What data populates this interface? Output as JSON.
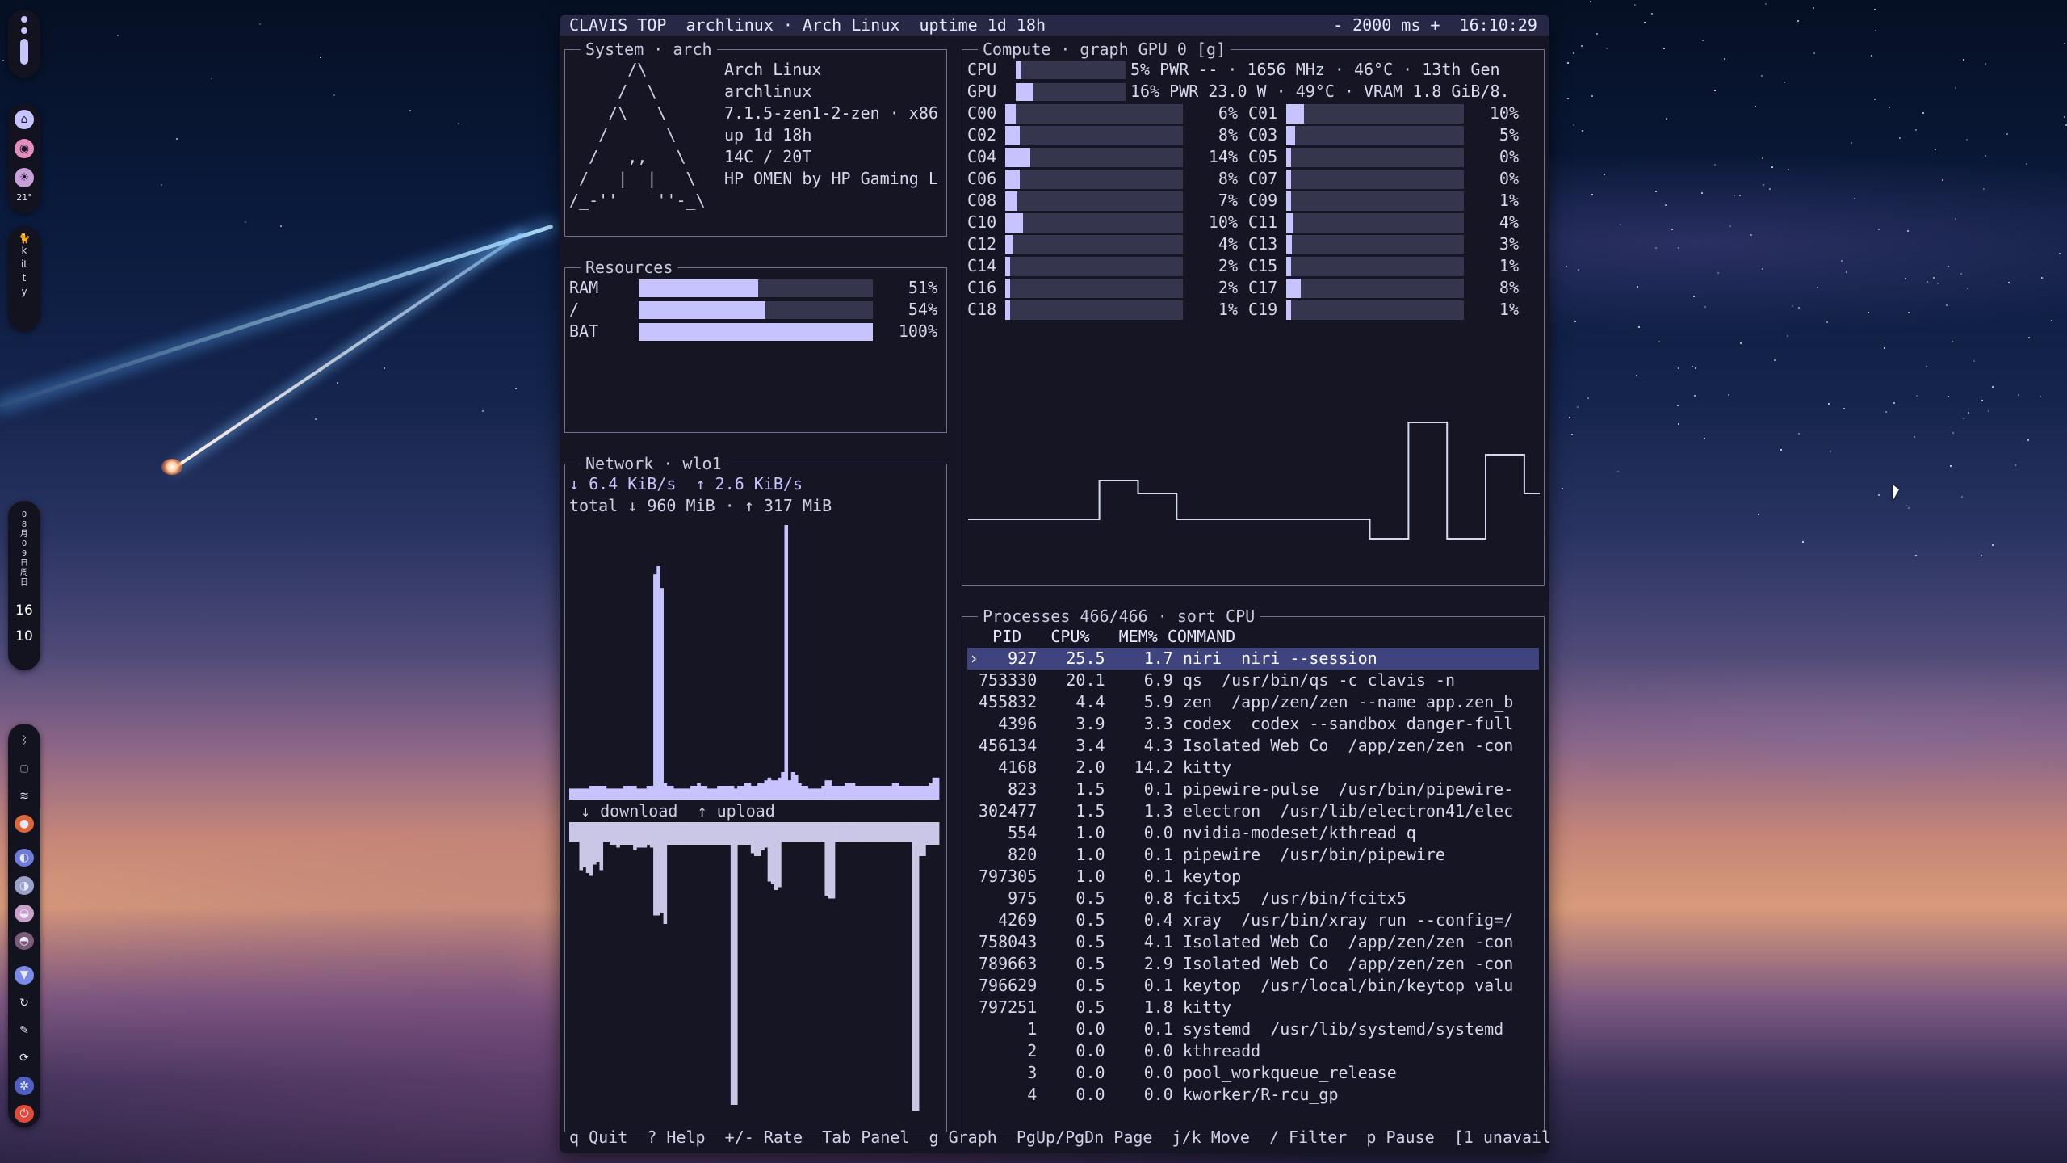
{
  "colors": {
    "accent": "#c6c3ff",
    "track": "#35364e",
    "bg": "#161524",
    "selection": "#3f437e"
  },
  "dock": {
    "top_icons": [
      "battery-icon",
      "bell-icon",
      "record-icon",
      "brightness-icon"
    ],
    "temperature": "21°",
    "kitty_label": "kitty",
    "date_text": "08月09日周日",
    "hour": "16",
    "minute": "10",
    "bottom_icons": [
      "bluetooth-icon",
      "clipboard-icon",
      "wifi-icon",
      "antivirus-icon",
      "gpu-icon",
      "audio-icon",
      "brightness-small-icon",
      "moon-icon",
      "network-icon",
      "performance-icon",
      "tools-icon",
      "settings-icon",
      "power-icon"
    ]
  },
  "title_bar": {
    "left": "CLAVIS TOP  archlinux · Arch Linux  uptime 1d 18h",
    "right": "- 2000 ms +  16:10:29"
  },
  "system": {
    "title": "System · arch",
    "art": [
      "      /\\",
      "     /  \\",
      "    /\\   \\",
      "   /      \\",
      "  /   ,,   \\",
      " /   |  |   \\",
      "/_-''    ''-_\\"
    ],
    "info": [
      "Arch Linux",
      "archlinux",
      "7.1.5-zen1-2-zen · x86",
      "up 1d 18h",
      "14C / 20T",
      "HP OMEN by HP Gaming L"
    ]
  },
  "resources": {
    "title": "Resources",
    "rows": [
      {
        "label": "RAM",
        "value": "51%",
        "fraction": 0.51
      },
      {
        "label": "/",
        "value": "54%",
        "fraction": 0.54
      },
      {
        "label": "BAT",
        "value": "100%",
        "fraction": 1.0
      }
    ]
  },
  "network": {
    "title": "Network · wlo1",
    "rates": "↓ 6.4 KiB/s  ↑ 2.6 KiB/s",
    "totals": "total ↓ 960 MiB · ↑ 317 MiB",
    "legend": "↓ download  ↑ upload",
    "download_history": [
      0.04,
      0.04,
      0.04,
      0.04,
      0.04,
      0.04,
      0.05,
      0.05,
      0.05,
      0.05,
      0.05,
      0.04,
      0.04,
      0.04,
      0.04,
      0.04,
      0.05,
      0.05,
      0.05,
      0.05,
      0.04,
      0.04,
      0.04,
      0.05,
      0.05,
      0.82,
      0.85,
      0.77,
      0.06,
      0.05,
      0.05,
      0.04,
      0.04,
      0.04,
      0.04,
      0.04,
      0.05,
      0.05,
      0.06,
      0.05,
      0.05,
      0.04,
      0.04,
      0.04,
      0.05,
      0.05,
      0.05,
      0.05,
      0.05,
      0.04,
      0.05,
      0.05,
      0.06,
      0.06,
      0.05,
      0.05,
      0.06,
      0.06,
      0.07,
      0.08,
      0.07,
      0.07,
      0.08,
      0.1,
      1.0,
      0.07,
      0.1,
      0.09,
      0.06,
      0.05,
      0.05,
      0.04,
      0.04,
      0.04,
      0.04,
      0.05,
      0.07,
      0.07,
      0.05,
      0.05,
      0.05,
      0.05,
      0.06,
      0.06,
      0.06,
      0.05,
      0.05,
      0.05,
      0.05,
      0.05,
      0.05,
      0.05,
      0.05,
      0.05,
      0.05,
      0.05,
      0.06,
      0.06,
      0.05,
      0.05,
      0.05,
      0.05,
      0.05,
      0.05,
      0.05,
      0.05,
      0.05,
      0.06,
      0.08,
      0.08
    ],
    "upload_history": [
      0.07,
      0.07,
      0.07,
      0.17,
      0.16,
      0.18,
      0.19,
      0.15,
      0.14,
      0.17,
      0.07,
      0.07,
      0.08,
      0.08,
      0.09,
      0.08,
      0.08,
      0.08,
      0.08,
      0.1,
      0.09,
      0.09,
      0.09,
      0.08,
      0.09,
      0.33,
      0.33,
      0.32,
      0.36,
      0.08,
      0.08,
      0.08,
      0.08,
      0.08,
      0.08,
      0.08,
      0.08,
      0.08,
      0.08,
      0.08,
      0.08,
      0.08,
      0.08,
      0.08,
      0.08,
      0.08,
      0.08,
      0.08,
      1.0,
      1.0,
      0.08,
      0.08,
      0.08,
      0.08,
      0.11,
      0.12,
      0.12,
      0.1,
      0.09,
      0.21,
      0.22,
      0.24,
      0.23,
      0.07,
      0.07,
      0.07,
      0.07,
      0.07,
      0.07,
      0.07,
      0.07,
      0.07,
      0.07,
      0.07,
      0.07,
      0.07,
      0.26,
      0.27,
      0.27,
      0.07,
      0.07,
      0.07,
      0.07,
      0.07,
      0.07,
      0.07,
      0.07,
      0.07,
      0.07,
      0.07,
      0.07,
      0.07,
      0.07,
      0.07,
      0.07,
      0.07,
      0.07,
      0.07,
      0.07,
      0.07,
      0.07,
      0.07,
      1.02,
      1.02,
      0.12,
      0.12,
      0.08,
      0.08,
      0.08,
      0.08
    ]
  },
  "compute": {
    "title": "Compute · graph GPU 0 [g]",
    "cpu": {
      "label": "CPU",
      "text": "5% PWR -- · 1656 MHz · 46°C · 13th Gen",
      "fraction": 0.05
    },
    "gpu": {
      "label": "GPU",
      "text": "16% PWR 23.0 W · 49°C · VRAM 1.8 GiB/8.",
      "fraction": 0.16
    },
    "cores": [
      {
        "label": "C00",
        "value": "6%",
        "fraction": 0.06
      },
      {
        "label": "C01",
        "value": "10%",
        "fraction": 0.1
      },
      {
        "label": "C02",
        "value": "8%",
        "fraction": 0.08
      },
      {
        "label": "C03",
        "value": "5%",
        "fraction": 0.05
      },
      {
        "label": "C04",
        "value": "14%",
        "fraction": 0.14
      },
      {
        "label": "C05",
        "value": "0%",
        "fraction": 0.0
      },
      {
        "label": "C06",
        "value": "8%",
        "fraction": 0.08
      },
      {
        "label": "C07",
        "value": "0%",
        "fraction": 0.0
      },
      {
        "label": "C08",
        "value": "7%",
        "fraction": 0.07
      },
      {
        "label": "C09",
        "value": "1%",
        "fraction": 0.01
      },
      {
        "label": "C10",
        "value": "10%",
        "fraction": 0.1
      },
      {
        "label": "C11",
        "value": "4%",
        "fraction": 0.04
      },
      {
        "label": "C12",
        "value": "4%",
        "fraction": 0.04
      },
      {
        "label": "C13",
        "value": "3%",
        "fraction": 0.03
      },
      {
        "label": "C14",
        "value": "2%",
        "fraction": 0.02
      },
      {
        "label": "C15",
        "value": "1%",
        "fraction": 0.01
      },
      {
        "label": "C16",
        "value": "2%",
        "fraction": 0.02
      },
      {
        "label": "C17",
        "value": "8%",
        "fraction": 0.08
      },
      {
        "label": "C18",
        "value": "1%",
        "fraction": 0.01
      },
      {
        "label": "C19",
        "value": "1%",
        "fraction": 0.01
      }
    ],
    "gpu_history": [
      0.25,
      0.25,
      0.25,
      0.25,
      0.25,
      0.25,
      0.25,
      0.25,
      0.25,
      0.25,
      0.25,
      0.25,
      0.25,
      0.25,
      0.25,
      0.25,
      0.25,
      0.25,
      0.25,
      0.25,
      0.25,
      0.25,
      0.25,
      0.25,
      0.25,
      0.25,
      0.25,
      0.25,
      0.25,
      0.25,
      0.25,
      0.25,
      0.25,
      0.25,
      0.55,
      0.55,
      0.55,
      0.55,
      0.55,
      0.55,
      0.55,
      0.55,
      0.55,
      0.55,
      0.45,
      0.45,
      0.45,
      0.45,
      0.45,
      0.45,
      0.45,
      0.45,
      0.45,
      0.45,
      0.25,
      0.25,
      0.25,
      0.25,
      0.25,
      0.25,
      0.25,
      0.25,
      0.25,
      0.25,
      0.25,
      0.25,
      0.25,
      0.25,
      0.25,
      0.25,
      0.25,
      0.25,
      0.25,
      0.25,
      0.25,
      0.25,
      0.25,
      0.25,
      0.25,
      0.25,
      0.25,
      0.25,
      0.25,
      0.25,
      0.25,
      0.25,
      0.25,
      0.25,
      0.25,
      0.25,
      0.25,
      0.25,
      0.25,
      0.25,
      0.25,
      0.25,
      0.25,
      0.25,
      0.25,
      0.25,
      0.25,
      0.25,
      0.25,
      0.25,
      0.1,
      0.1,
      0.1,
      0.1,
      0.1,
      0.1,
      0.1,
      0.1,
      0.1,
      0.1,
      1.0,
      1.0,
      1.0,
      1.0,
      1.0,
      1.0,
      1.0,
      1.0,
      1.0,
      1.0,
      0.1,
      0.1,
      0.1,
      0.1,
      0.1,
      0.1,
      0.1,
      0.1,
      0.1,
      0.1,
      0.75,
      0.75,
      0.75,
      0.75,
      0.75,
      0.75,
      0.75,
      0.75,
      0.75,
      0.75,
      0.45,
      0.45,
      0.45,
      0.45
    ]
  },
  "processes": {
    "title": "Processes 466/466 · sort CPU",
    "header": "  PID   CPU%   MEM% COMMAND",
    "cursor": "›",
    "rows": [
      "   927   25.5    1.7 niri  niri --session",
      "753330   20.1    6.9 qs  /usr/bin/qs -c clavis -n",
      "455832    4.4    5.9 zen  /app/zen/zen --name app.zen_b",
      "  4396    3.9    3.3 codex  codex --sandbox danger-full",
      "456134    3.4    4.3 Isolated Web Co  /app/zen/zen -con",
      "  4168    2.0   14.2 kitty",
      "   823    1.5    0.1 pipewire-pulse  /usr/bin/pipewire-",
      "302477    1.5    1.3 electron  /usr/lib/electron41/elec",
      "   554    1.0    0.0 nvidia-modeset/kthread_q",
      "   820    1.0    0.1 pipewire  /usr/bin/pipewire",
      "797305    1.0    0.1 keytop",
      "   975    0.5    0.8 fcitx5  /usr/bin/fcitx5",
      "  4269    0.5    0.4 xray  /usr/bin/xray run --config=/",
      "758043    0.5    4.1 Isolated Web Co  /app/zen/zen -con",
      "789663    0.5    2.9 Isolated Web Co  /app/zen/zen -con",
      "796629    0.5    0.1 keytop  /usr/local/bin/keytop valu",
      "797251    0.5    1.8 kitty",
      "     1    0.0    0.1 systemd  /usr/lib/systemd/systemd",
      "     2    0.0    0.0 kthreadd",
      "     3    0.0    0.0 pool_workqueue_release",
      "     4    0.0    0.0 kworker/R-rcu_gp"
    ]
  },
  "footer": "q Quit  ? Help  +/- Rate  Tab Panel  g Graph  PgUp/PgDn Page  j/k Move  / Filter  p Pause  [1 unavail"
}
